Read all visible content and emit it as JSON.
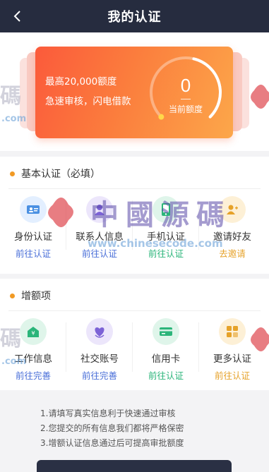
{
  "header": {
    "title": "我的认证",
    "back_icon": "chevron-left-icon"
  },
  "hero": {
    "line1": "最高20,000额度",
    "line2": "急速审核，闪电借款",
    "gauge_value": "0",
    "gauge_label": "当前额度",
    "gauge_fill": 0.45
  },
  "basic": {
    "title": "基本认证（必填）",
    "items": [
      {
        "label": "身份认证",
        "status": "前往认证",
        "icon": "id-card-icon",
        "color": "#4a90e2",
        "bg": "#e3efff"
      },
      {
        "label": "联系人信息",
        "status": "前往认证",
        "icon": "contact-icon",
        "color": "#7c62d6",
        "bg": "#ece6fb"
      },
      {
        "label": "手机认证",
        "status": "前往认证",
        "icon": "phone-icon",
        "color": "#2bb57a",
        "bg": "#dff5ea"
      },
      {
        "label": "邀请好友",
        "status": "去邀请",
        "icon": "invite-icon",
        "color": "#e6a229",
        "bg": "#fdf0d6"
      }
    ]
  },
  "extra": {
    "title": "增额项",
    "items": [
      {
        "label": "工作信息",
        "status": "前往完善",
        "icon": "work-icon",
        "color": "#2bb57a",
        "bg": "#dff5ea"
      },
      {
        "label": "社交账号",
        "status": "前往完善",
        "icon": "social-icon",
        "color": "#7c62d6",
        "bg": "#ece6fb"
      },
      {
        "label": "信用卡",
        "status": "前往认证",
        "icon": "credit-card-icon",
        "color": "#2bb57a",
        "bg": "#dff5ea"
      },
      {
        "label": "更多认证",
        "status": "前往认证",
        "icon": "more-icon",
        "color": "#e6a229",
        "bg": "#fdf0d6"
      }
    ]
  },
  "notes": [
    "1.请填写真实信息利于快速通过审核",
    "2.您提交的所有信息我们都将严格保密",
    "3.增额认证信息通过后可提高审批额度"
  ],
  "watermark": {
    "text_main": "中國源碼",
    "text_url": "www.chinesecode.com",
    "side_char": "碼",
    "side_url": ".com",
    "logo": "watermark-logo"
  },
  "colors": {
    "header_bg": "#262c3f",
    "accent_orange": "#f19a24",
    "status_blue": "#4a6fd8",
    "status_gold": "#e6a229"
  }
}
